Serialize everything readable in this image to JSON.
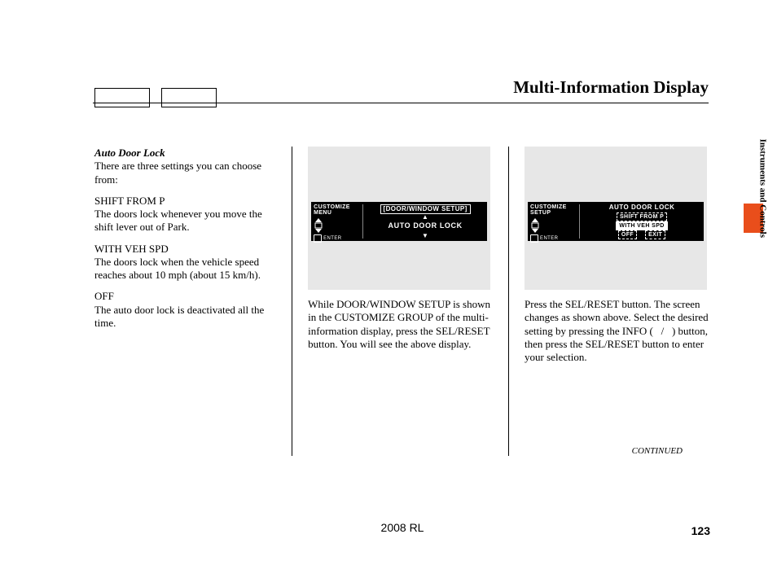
{
  "header": {
    "title": "Multi-Information Display"
  },
  "col1": {
    "subheading": "Auto Door Lock",
    "intro": "There are three settings you can choose from:",
    "opt1_title": "SHIFT FROM P",
    "opt1_body": "The doors lock whenever you move the shift lever out of Park.",
    "opt2_title": "WITH VEH SPD",
    "opt2_body": "The doors lock when the vehicle speed reaches about 10 mph (about 15 km/h).",
    "opt3_title": "OFF",
    "opt3_body": "The auto door lock is deactivated all the time."
  },
  "col2": {
    "screen": {
      "left_line1": "CUSTOMIZE",
      "left_line2": "MENU",
      "enter": "ENTER",
      "boxed": "[DOOR/WINDOW SETUP]",
      "mid": "AUTO DOOR LOCK"
    },
    "body": "While DOOR/WINDOW SETUP is shown in the CUSTOMIZE GROUP of the multi-information display, press the SEL/RESET button. You will see the above display."
  },
  "col3": {
    "screen": {
      "left_line1": "CUSTOMIZE",
      "left_line2": "SETUP",
      "enter": "ENTER",
      "title": "AUTO DOOR LOCK",
      "opt1": "SHIFT FROM P",
      "opt2": "WITH VEH SPD",
      "opt3": "OFF",
      "exit": "EXIT"
    },
    "body": "Press the SEL/RESET button. The screen changes as shown above. Select the desired setting by pressing the INFO (   /   ) button, then press the SEL/RESET button to enter your selection."
  },
  "side": {
    "section": "Instruments and Controls"
  },
  "footer": {
    "continued": "CONTINUED",
    "model": "2008  RL",
    "page": "123"
  }
}
